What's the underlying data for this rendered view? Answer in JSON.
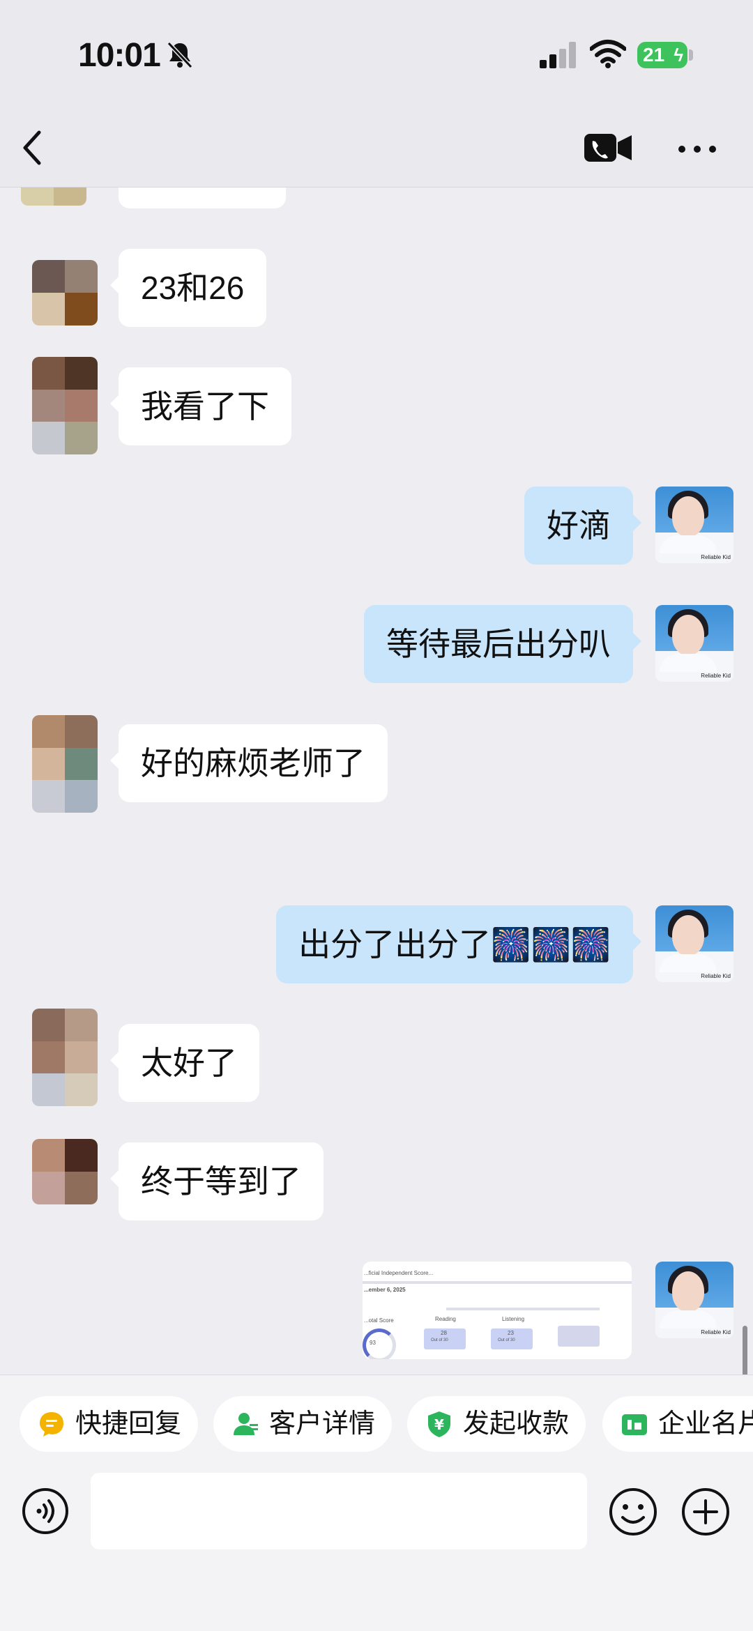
{
  "status_bar": {
    "time": "10:01",
    "battery": "21"
  },
  "messages": [
    {
      "side": "in",
      "text": "23和26"
    },
    {
      "side": "in",
      "text": "我看了下"
    },
    {
      "side": "out",
      "text": "好滴"
    },
    {
      "side": "out",
      "text": "等待最后出分叭"
    },
    {
      "side": "in",
      "text": "好的麻烦老师了"
    },
    {
      "side": "out",
      "text": "出分了出分了🎆🎆🎆"
    },
    {
      "side": "in",
      "text": "太好了"
    },
    {
      "side": "in",
      "text": "终于等到了"
    }
  ],
  "shared_image": {
    "header": "...ficial Independent Score...",
    "date": "...ember 6, 2025",
    "total_label": "...otal Score",
    "total_value": "93",
    "reading_label": "Reading",
    "reading_value": "28",
    "listening_label": "Listening",
    "listening_value": "23",
    "out_of": "Out of 30"
  },
  "avatar_watermark": "Reliable Kid",
  "quick_actions": [
    {
      "label": "快捷回复",
      "icon": "quick-reply-icon",
      "color": "#F5B301"
    },
    {
      "label": "客户详情",
      "icon": "customer-detail-icon",
      "color": "#2DB55D"
    },
    {
      "label": "发起收款",
      "icon": "payment-icon",
      "color": "#2DB55D"
    },
    {
      "label": "企业名片",
      "icon": "business-card-icon",
      "color": "#2DB55D"
    }
  ],
  "input": {
    "value": ""
  }
}
